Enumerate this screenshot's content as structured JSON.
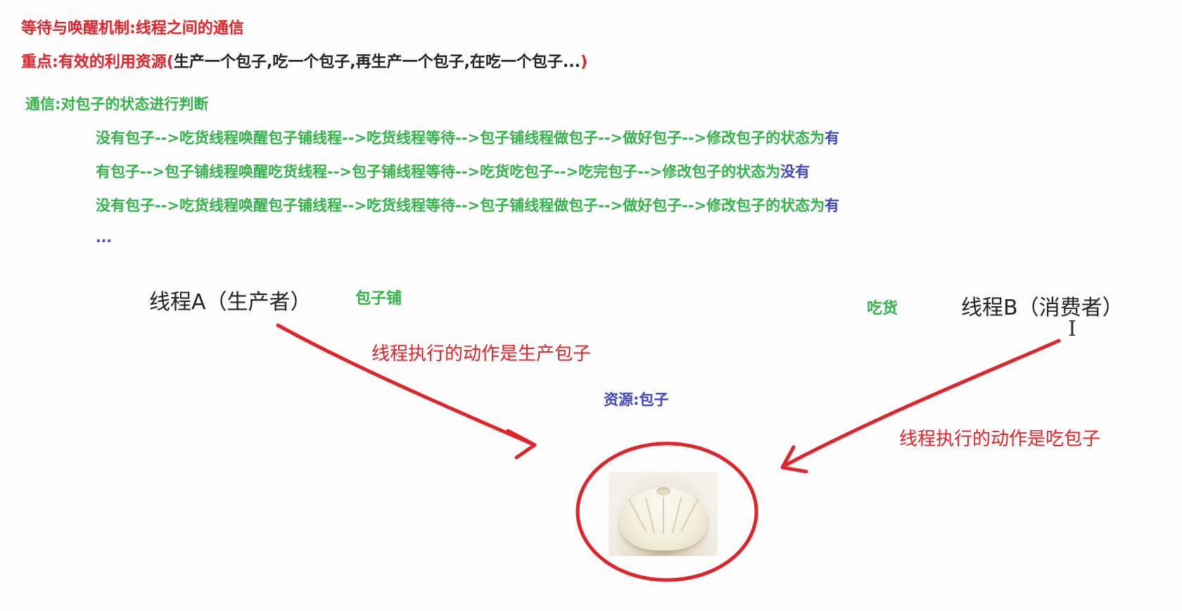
{
  "title": "等待与唤醒机制:线程之间的通信",
  "key_point": {
    "label": "重点:有效的利用资源(",
    "detail": "生产一个包子,吃一个包子,再生产一个包子,在吃一个包子...",
    "close": ")"
  },
  "communication": "通信:对包子的状态进行判断",
  "flows": [
    {
      "text": "没有包子-->吃货线程唤醒包子铺线程-->吃货线程等待-->包子铺线程做包子-->做好包子-->修改包子的状态为",
      "end": "有"
    },
    {
      "text": "有包子-->包子铺线程唤醒吃货线程-->包子铺线程等待-->吃货吃包子-->吃完包子-->修改包子的状态为",
      "end": "没有"
    },
    {
      "text": "没有包子-->吃货线程唤醒包子铺线程-->吃货线程等待-->包子铺线程做包子-->做好包子-->修改包子的状态为",
      "end": "有"
    }
  ],
  "ellipsis": "...",
  "producer": {
    "thread": "线程A（生产者）",
    "role": "包子铺",
    "action": "线程执行的动作是生产包子"
  },
  "consumer": {
    "thread": "线程B（消费者）",
    "role": "吃货",
    "action": "线程执行的动作是吃包子"
  },
  "resource": "资源:包子",
  "colors": {
    "red": "#e0242a",
    "green": "#33b44a",
    "blue": "#3f47c9"
  },
  "icons": [
    "text-cursor-icon",
    "steamed-bun-image"
  ]
}
